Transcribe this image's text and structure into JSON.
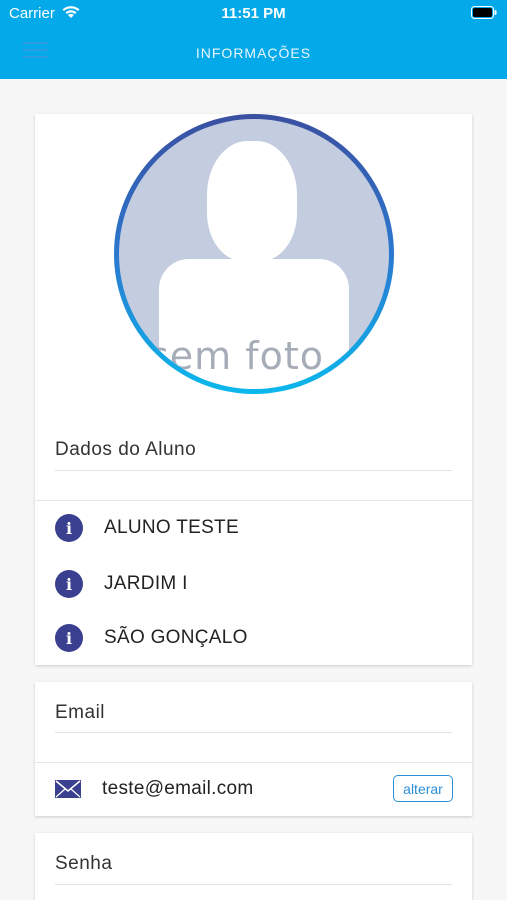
{
  "status_bar": {
    "carrier": "Carrier",
    "time": "11:51 PM"
  },
  "nav": {
    "title": "INFORMAÇÕES",
    "menu_icon": "hamburger-menu-icon"
  },
  "profile": {
    "photo_placeholder_text": "sem foto",
    "section_title": "Dados do Aluno",
    "items": [
      {
        "icon": "info-icon",
        "text": "ALUNO TESTE"
      },
      {
        "icon": "info-icon",
        "text": "JARDIM I"
      },
      {
        "icon": "info-icon",
        "text": "SÃO GONÇALO"
      }
    ]
  },
  "email_card": {
    "section_title": "Email",
    "icon": "envelope-icon",
    "value": "teste@email.com",
    "edit_label": "alterar"
  },
  "password_card": {
    "section_title": "Senha"
  },
  "colors": {
    "nav_background": "#03a9e8",
    "info_icon": "#3a3f8f",
    "button_accent": "#2b8fd8"
  }
}
